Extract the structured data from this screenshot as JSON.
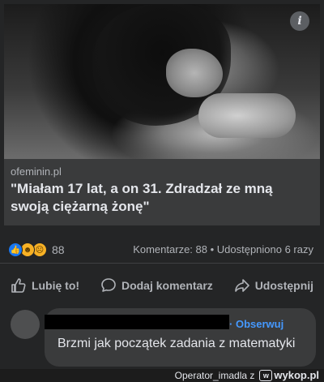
{
  "post": {
    "info_icon": "i",
    "link": {
      "domain": "ofeminin.pl",
      "headline": "\"Miałam 17 lat, a on 31. Zdradzał ze mną swoją ciężarną żonę\""
    },
    "reactions": {
      "icons": [
        "like-icon",
        "haha-icon",
        "sad-icon"
      ],
      "count": "88"
    },
    "stats_right": "Komentarze: 88 • Udostępniono 6 razy",
    "actions": {
      "like": "Lubię to!",
      "comment": "Dodaj komentarz",
      "share": "Udostępnij"
    }
  },
  "comment": {
    "follow_label": "Obserwuj",
    "follow_prefix": "·",
    "text": "Brzmi jak początek zadania z matematyki"
  },
  "watermark": {
    "text": "Operator_imadla z",
    "logo_text": "wykop.pl"
  },
  "colors": {
    "background": "#242526",
    "link_block": "#3a3b3c",
    "follow_blue": "#4599ff",
    "like_blue": "#1877f2"
  }
}
